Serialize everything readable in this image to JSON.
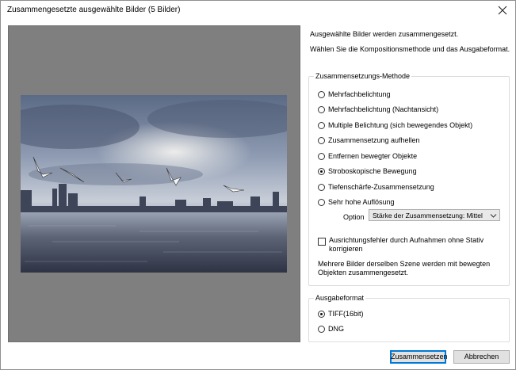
{
  "window": {
    "title": "Zusammengesetzte ausgewählte Bilder (5 Bilder)"
  },
  "info": {
    "line1": "Ausgewählte Bilder werden zusammengesetzt.",
    "line2": "Wählen Sie die Kompositionsmethode und das Ausgabeformat."
  },
  "method": {
    "title": "Zusammensetzungs-Methode",
    "options": [
      "Mehrfachbelichtung",
      "Mehrfachbelichtung (Nachtansicht)",
      "Multiple Belichtung (sich bewegendes Objekt)",
      "Zusammensetzung aufhellen",
      "Entfernen bewegter Objekte",
      "Stroboskopische Bewegung",
      "Tiefenschärfe-Zusammensetzung",
      "Sehr hohe Auflösung"
    ],
    "selected_index": 5,
    "option_label": "Option",
    "option_value": "Stärke der Zusammensetzung: Mittel",
    "checkbox_label": "Ausrichtungsfehler durch Aufnahmen ohne Stativ korrigieren",
    "checkbox_checked": false,
    "description": "Mehrere Bilder derselben Szene werden mit bewegten Objekten zusammengesetzt."
  },
  "output": {
    "title": "Ausgabeformat",
    "options": [
      "TIFF(16bit)",
      "DNG"
    ],
    "selected_index": 0
  },
  "buttons": {
    "compose": "Zusammensetzen",
    "cancel": "Abbrechen"
  },
  "colors": {
    "accent": "#0078d7",
    "preview_bg": "#7f7f7f"
  }
}
